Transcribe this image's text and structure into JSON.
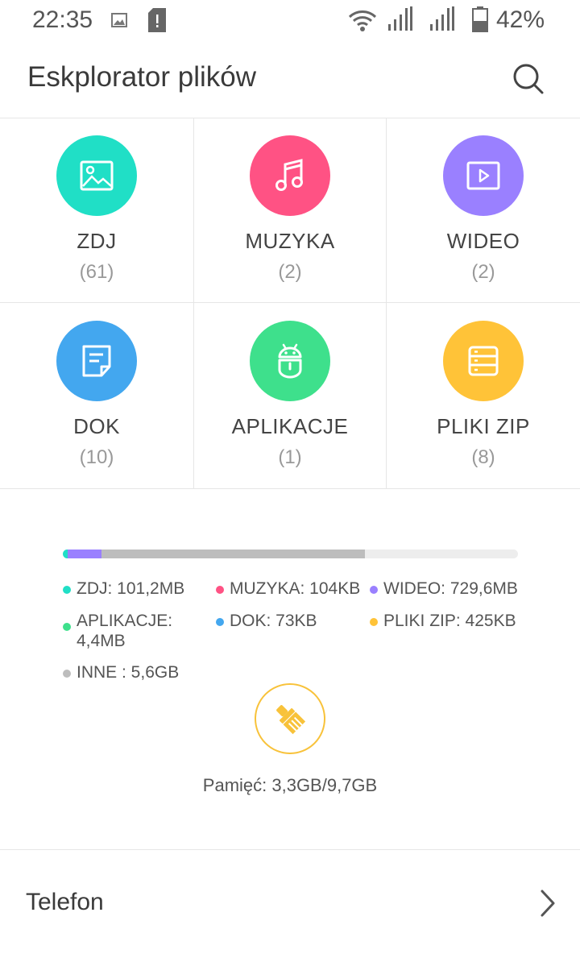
{
  "status_bar": {
    "time": "22:35",
    "battery": "42%",
    "icons": [
      "image-icon",
      "sd-card-icon",
      "wifi-icon",
      "signal-icon",
      "signal-icon",
      "battery-icon"
    ]
  },
  "header": {
    "title": "Eskplorator plików",
    "search_icon": "search-icon"
  },
  "categories": [
    {
      "label": "ZDJ",
      "count": "(61)",
      "color": "#20dfc6",
      "icon": "image-icon"
    },
    {
      "label": "MUZYKA",
      "count": "(2)",
      "color": "#ff5284",
      "icon": "music-icon"
    },
    {
      "label": "WIDEO",
      "count": "(2)",
      "color": "#9a80ff",
      "icon": "video-icon"
    },
    {
      "label": "DOK",
      "count": "(10)",
      "color": "#43a7ef",
      "icon": "document-icon"
    },
    {
      "label": "APLIKACJE",
      "count": "(1)",
      "color": "#3ee08c",
      "icon": "android-icon"
    },
    {
      "label": "PLIKI ZIP",
      "count": "(8)",
      "color": "#ffc338",
      "icon": "archive-icon"
    }
  ],
  "storage": {
    "legend": [
      {
        "text": "ZDJ: 101,2MB",
        "color": "#20dfc6"
      },
      {
        "text": "MUZYKA: 104KB",
        "color": "#ff5284"
      },
      {
        "text": "WIDEO: 729,6MB",
        "color": "#9a80ff"
      },
      {
        "text": "APLIKACJE: 4,4MB",
        "line1": "APLIKACJE:",
        "line2": "4,4MB",
        "color": "#3ee08c"
      },
      {
        "text": "DOK: 73KB",
        "color": "#43a7ef"
      },
      {
        "text": "PLIKI ZIP: 425KB",
        "color": "#ffc338"
      },
      {
        "text": "INNE : 5,6GB",
        "color": "#bdbdbd"
      }
    ],
    "usage_fractions": {
      "ZDJ": 0.01,
      "WIDEO": 0.075,
      "INNE": 0.578
    },
    "memory": "Pamięć: 3,3GB/9,7GB",
    "clean_icon": "broom-icon"
  },
  "phone_row": {
    "label": "Telefon",
    "icon": "chevron-right-icon"
  }
}
